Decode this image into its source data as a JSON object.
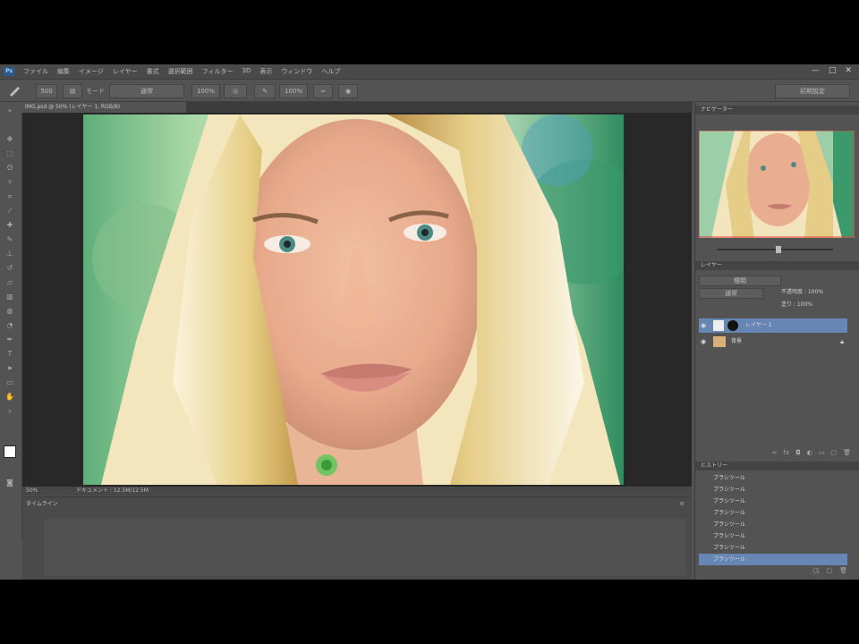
{
  "app": {
    "logo": "Ps",
    "menu": [
      "ファイル",
      "編集",
      "イメージ",
      "レイヤー",
      "書式",
      "選択範囲",
      "フィルター",
      "3D",
      "表示",
      "ウィンドウ",
      "ヘルプ"
    ],
    "window_controls": [
      "—",
      "□",
      "✕"
    ]
  },
  "options_bar": {
    "brush_size": "500",
    "mode": "通常",
    "opacity": "100%",
    "flow": "100%",
    "workspace": "初期設定"
  },
  "document": {
    "tab_title": "IMG.psd @ 50% (レイヤー 1, RGB/8)",
    "zoom": "50%",
    "status_info": "ドキュメント : 12.5M/12.5M"
  },
  "timeline": {
    "title": "タイムライン"
  },
  "navigator": {
    "title": "ナビゲーター"
  },
  "layers": {
    "title": "レイヤー",
    "blend_mode": "通常",
    "opacity_label": "不透明度 : 100%",
    "fill_label": "塗り : 100%",
    "items": [
      {
        "name": "レイヤー 1",
        "selected": true
      },
      {
        "name": "背景",
        "selected": false
      }
    ]
  },
  "history": {
    "title": "ヒストリー",
    "items": [
      "ブラシツール",
      "ブラシツール",
      "ブラシツール",
      "ブラシツール",
      "ブラシツール",
      "ブラシツール",
      "ブラシツール",
      "ブラシツール"
    ],
    "selected_index": 7
  },
  "colors": {
    "app_bg": "#535353",
    "panel_dark": "#444444",
    "selection": "#6786b3"
  }
}
